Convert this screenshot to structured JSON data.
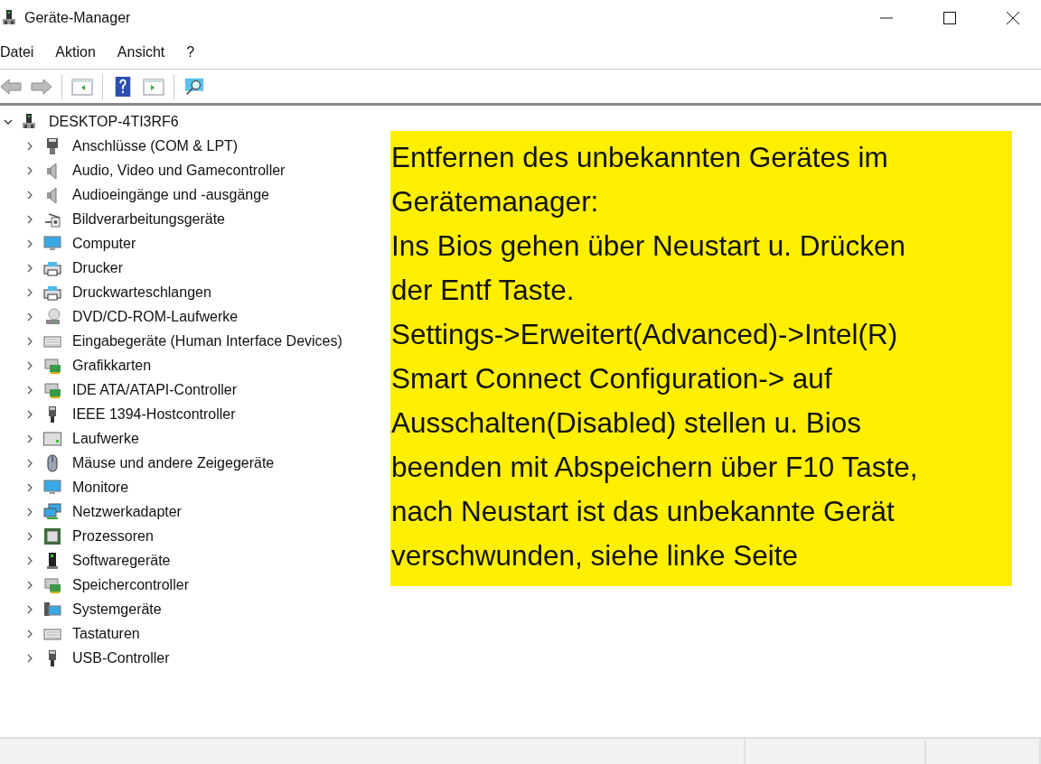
{
  "window": {
    "title": "Geräte-Manager"
  },
  "menu": [
    "Datei",
    "Aktion",
    "Ansicht",
    "?"
  ],
  "tree": {
    "label": "DESKTOP-4TI3RF6",
    "expanded": true,
    "children": [
      {
        "label": "Anschlüsse (COM & LPT)",
        "kind": "port",
        "expanded": false
      },
      {
        "label": "Audio, Video und Gamecontroller",
        "kind": "speaker",
        "expanded": false
      },
      {
        "label": "Audioeingänge und -ausgänge",
        "kind": "speaker",
        "expanded": false
      },
      {
        "label": "Bildverarbeitungsgeräte",
        "kind": "camera",
        "expanded": false
      },
      {
        "label": "Computer",
        "kind": "monitor",
        "expanded": false
      },
      {
        "label": "Drucker",
        "kind": "printer",
        "expanded": false
      },
      {
        "label": "Druckwarteschlangen",
        "kind": "printer",
        "expanded": false
      },
      {
        "label": "DVD/CD-ROM-Laufwerke",
        "kind": "disc",
        "expanded": false
      },
      {
        "label": "Eingabegeräte (Human Interface Devices)",
        "kind": "keyboard",
        "expanded": false
      },
      {
        "label": "Grafikkarten",
        "kind": "card",
        "expanded": false
      },
      {
        "label": "IDE ATA/ATAPI-Controller",
        "kind": "card",
        "expanded": false
      },
      {
        "label": "IEEE 1394-Hostcontroller",
        "kind": "plug",
        "expanded": false
      },
      {
        "label": "Laufwerke",
        "kind": "drive",
        "expanded": false
      },
      {
        "label": "Mäuse und andere Zeigegeräte",
        "kind": "mouse",
        "expanded": false
      },
      {
        "label": "Monitore",
        "kind": "monitor",
        "expanded": false
      },
      {
        "label": "Netzwerkadapter",
        "kind": "network",
        "expanded": false
      },
      {
        "label": "Prozessoren",
        "kind": "chip",
        "expanded": false
      },
      {
        "label": "Softwaregeräte",
        "kind": "tower",
        "expanded": false
      },
      {
        "label": "Speichercontroller",
        "kind": "card",
        "expanded": false
      },
      {
        "label": "Systemgeräte",
        "kind": "system",
        "expanded": false
      },
      {
        "label": "Tastaturen",
        "kind": "keyboard",
        "expanded": false
      },
      {
        "label": "USB-Controller",
        "kind": "plug",
        "expanded": false
      }
    ]
  },
  "note": {
    "lines": [
      "Entfernen des unbekannten Gerätes im",
      "Gerätemanager:",
      "Ins Bios gehen über Neustart u. Drücken",
      "der Entf Taste.",
      "Settings->Erweitert(Advanced)->Intel(R)",
      "Smart Connect Configuration-> auf",
      "Ausschalten(Disabled) stellen u. Bios",
      "beenden mit Abspeichern über F10 Taste,",
      "nach Neustart ist das unbekannte Gerät",
      "verschwunden, siehe linke Seite"
    ]
  }
}
